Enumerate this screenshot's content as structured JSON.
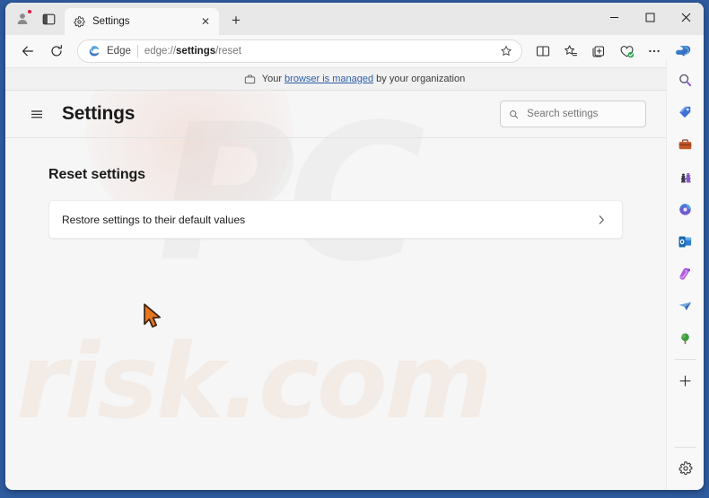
{
  "window": {
    "controls": {
      "minimize": "–",
      "maximize": "□",
      "close": "✕"
    }
  },
  "tabstrip": {
    "profile_name": "profile-avatar",
    "tab_actions_label": "tab-actions",
    "tabs": [
      {
        "title": "Settings",
        "icon": "gear-icon",
        "close_label": "✕"
      }
    ],
    "new_tab_label": "+"
  },
  "navbar": {
    "back_label": "←",
    "refresh_label": "↻",
    "omnibox": {
      "brand": "Edge",
      "url_prefix": "edge://",
      "url_bold": "settings",
      "url_suffix": "/reset",
      "full_url": "edge://settings/reset"
    },
    "icons": [
      "favorite-star-icon",
      "split-screen-icon",
      "favorites-icon",
      "collections-icon",
      "browser-essentials-icon",
      "more-options-icon",
      "copilot-icon"
    ]
  },
  "managed_notice": {
    "prefix": "Your ",
    "link": "browser is managed",
    "suffix": " by your organization",
    "icon": "briefcase-icon"
  },
  "settings_page": {
    "menu_icon": "hamburger-menu-icon",
    "title": "Settings",
    "search": {
      "placeholder": "Search settings",
      "value": "",
      "icon": "search-icon"
    },
    "section_title": "Reset settings",
    "rows": [
      {
        "label": "Restore settings to their default values",
        "chevron": "›"
      }
    ]
  },
  "sidebar": {
    "items": [
      {
        "name": "search",
        "label": "Search"
      },
      {
        "name": "shopping",
        "label": "Shopping"
      },
      {
        "name": "tools",
        "label": "Tools"
      },
      {
        "name": "games",
        "label": "Games"
      },
      {
        "name": "designer",
        "label": "Designer"
      },
      {
        "name": "outlook",
        "label": "Outlook"
      },
      {
        "name": "image-creator",
        "label": "Image Creator"
      },
      {
        "name": "drop",
        "label": "Drop"
      },
      {
        "name": "planet",
        "label": "Planet"
      }
    ],
    "add_label": "+",
    "customize_label": "Customize"
  },
  "watermarks": {
    "big": "PC",
    "small": "risk.com"
  },
  "colors": {
    "desktop": "#2e5b9e",
    "accent_link": "#2a5fa8",
    "cursor": "#e8761f",
    "notification_dot": "#e8173d"
  }
}
